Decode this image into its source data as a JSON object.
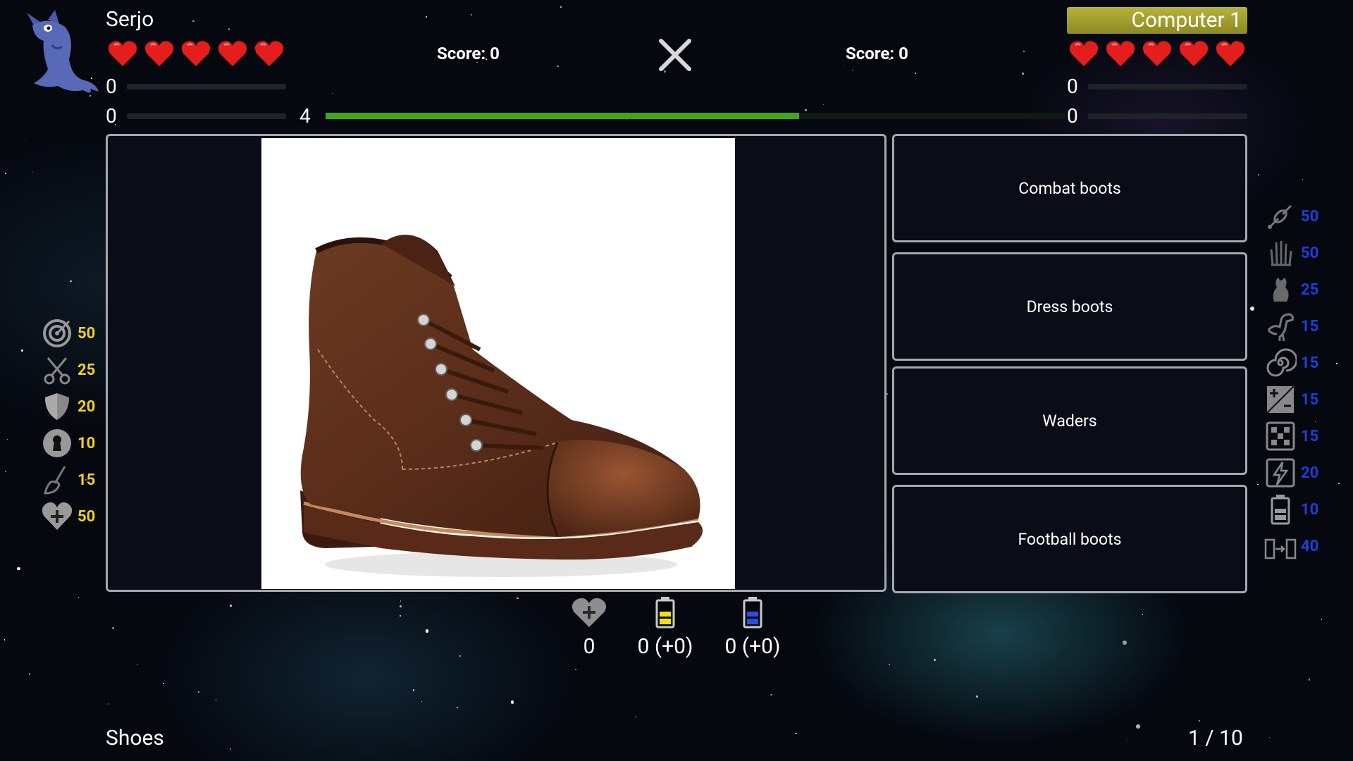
{
  "player": {
    "name": "Serjo",
    "score_label": "Score: 0",
    "stat_top": "0",
    "stat_bottom": "0",
    "hearts": 5
  },
  "opponent": {
    "name": "Computer 1",
    "score_label": "Score: 0",
    "stat_top": "0",
    "stat_bottom": "0",
    "hearts": 5
  },
  "timer": {
    "value": "4",
    "progress": 0.64
  },
  "question": {
    "image_alt": "brown leather lace-up boot"
  },
  "answers": [
    {
      "label": "Combat boots"
    },
    {
      "label": "Dress boots"
    },
    {
      "label": "Waders"
    },
    {
      "label": "Football boots"
    }
  ],
  "left_abilities": [
    {
      "icon": "target-icon",
      "value": "50"
    },
    {
      "icon": "scissors-icon",
      "value": "25"
    },
    {
      "icon": "shield-icon",
      "value": "20"
    },
    {
      "icon": "keyhole-icon",
      "value": "10"
    },
    {
      "icon": "broom-icon",
      "value": "15"
    },
    {
      "icon": "heart-plus-icon",
      "value": "50"
    }
  ],
  "right_abilities": [
    {
      "icon": "satellite-icon",
      "value": "50"
    },
    {
      "icon": "hand-icon",
      "value": "50"
    },
    {
      "icon": "creature-icon",
      "value": "25"
    },
    {
      "icon": "dinosaur-icon",
      "value": "15"
    },
    {
      "icon": "spiral-icon",
      "value": "15"
    },
    {
      "icon": "plus-minus-icon",
      "value": "15"
    },
    {
      "icon": "dice-icon",
      "value": "15"
    },
    {
      "icon": "lightning-icon",
      "value": "20"
    },
    {
      "icon": "battery-icon",
      "value": "10"
    },
    {
      "icon": "battery-transfer-icon",
      "value": "40"
    }
  ],
  "bottom_stats": {
    "hearts": "0",
    "yellow_energy": "0 (+0)",
    "blue_energy": "0 (+0)"
  },
  "footer": {
    "category": "Shoes",
    "counter": "1 / 10"
  },
  "colors": {
    "accent_green": "#3ea51c",
    "heart_red": "#e41d1d",
    "left_value": "#f2d022",
    "right_value": "#1d3fd9",
    "badge": "#a9a72f"
  }
}
